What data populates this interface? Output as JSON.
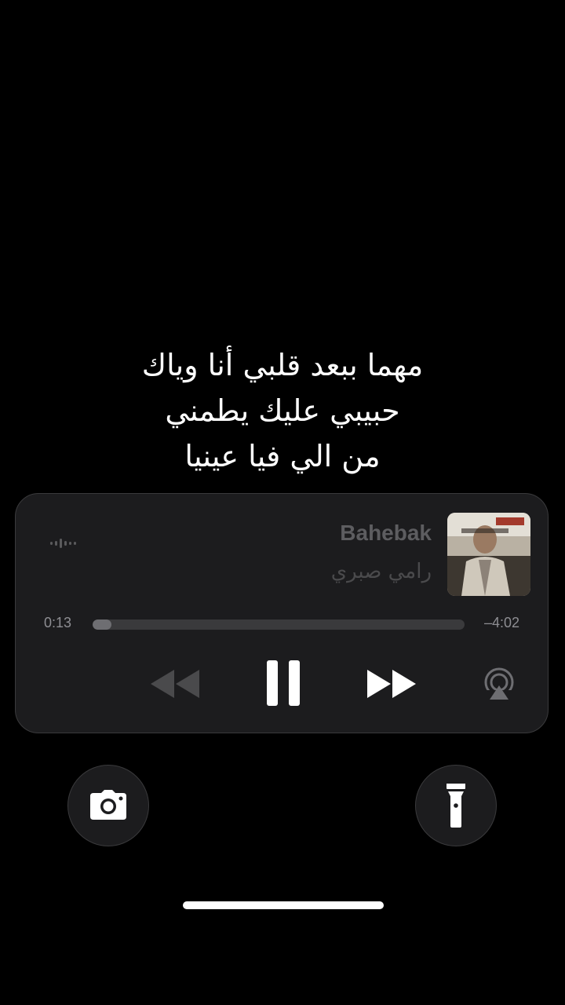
{
  "lyrics": {
    "lines": [
      "مهما ببعد قلبي أنا وياك",
      "حبيبي عليك يطمني",
      "من الي فيا عينيا"
    ]
  },
  "now_playing": {
    "title": "Bahebak",
    "artist": "رامي صبري",
    "elapsed": "0:13",
    "remaining": "–4:02",
    "progress": 0.05,
    "state": "playing"
  },
  "icons": {
    "waveform": "waveform-icon",
    "rewind": "backward-icon",
    "pause": "pause-icon",
    "forward": "forward-icon",
    "airplay": "airplay-icon",
    "camera": "camera-icon",
    "flashlight": "flashlight-icon"
  },
  "colors": {
    "background": "#000000",
    "player_bg": "#1c1c1e",
    "text_dim": "#5d5d60",
    "control_white": "#ffffff",
    "control_dim": "#4a4a4c"
  }
}
